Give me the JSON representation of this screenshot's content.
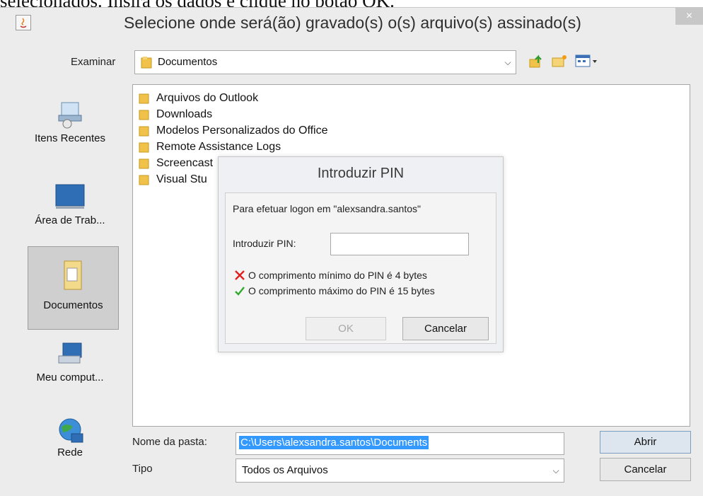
{
  "doc": {
    "top_caption": "selecionados. Insira os dados e clique no botão OK."
  },
  "window": {
    "title": "Selecione onde será(ão) gravado(s) o(s) arquivo(s) assinado(s)",
    "close_label": "×"
  },
  "lookin": {
    "label": "Examinar",
    "value": "Documentos"
  },
  "places": [
    {
      "label": "Itens Recentes",
      "icon": "recent-items-icon"
    },
    {
      "label": "Área de Trab...",
      "icon": "desktop-icon"
    },
    {
      "label": "Documentos",
      "icon": "documents-icon",
      "selected": true
    },
    {
      "label": "Meu comput...",
      "icon": "computer-icon"
    },
    {
      "label": "Rede",
      "icon": "network-icon"
    }
  ],
  "files": [
    {
      "name": "Arquivos do Outlook"
    },
    {
      "name": "Downloads"
    },
    {
      "name": "Modelos Personalizados do Office"
    },
    {
      "name": "Remote Assistance Logs"
    },
    {
      "name": "Screencast"
    },
    {
      "name": "Visual Stu"
    }
  ],
  "pin_dialog": {
    "title": "Introduzir PIN",
    "logon_text": "Para efetuar logon em \"alexsandra.santos\"",
    "pin_label": "Introduzir PIN:",
    "pin_value": "",
    "rules": [
      {
        "text": "O comprimento mínimo do PIN é 4 bytes",
        "status": "fail",
        "color": "#e02020"
      },
      {
        "text": "O comprimento máximo do PIN é 15 bytes",
        "status": "ok",
        "color": "#2eaa2e"
      }
    ],
    "ok_label": "OK",
    "cancel_label": "Cancelar"
  },
  "bottom": {
    "folder_label": "Nome da pasta:",
    "folder_value": "C:\\Users\\alexsandra.santos\\Documents",
    "type_label": "Tipo",
    "type_value": "Todos os Arquivos",
    "open_label": "Abrir",
    "cancel_label": "Cancelar"
  }
}
